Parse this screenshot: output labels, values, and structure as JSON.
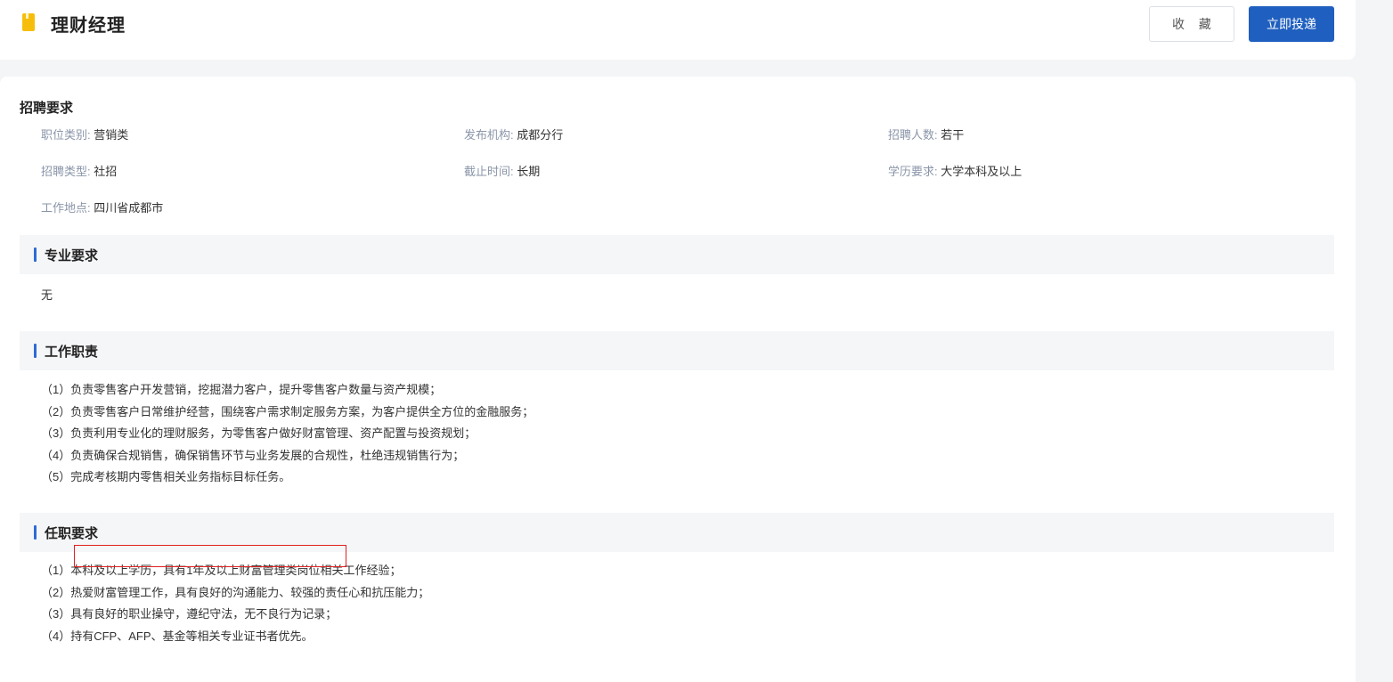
{
  "header": {
    "title": "理财经理",
    "collect_label": "收 藏",
    "apply_label": "立即投递"
  },
  "requirements": {
    "heading": "招聘要求",
    "items": [
      {
        "key": "职位类别:",
        "value": "营销类"
      },
      {
        "key": "发布机构:",
        "value": "成都分行"
      },
      {
        "key": "招聘人数:",
        "value": "若干"
      },
      {
        "key": "招聘类型:",
        "value": "社招"
      },
      {
        "key": "截止时间:",
        "value": "长期"
      },
      {
        "key": "学历要求:",
        "value": "大学本科及以上"
      },
      {
        "key": "工作地点:",
        "value": "四川省成都市"
      }
    ]
  },
  "major": {
    "title": "专业要求",
    "text": "无"
  },
  "duties": {
    "title": "工作职责",
    "lines": [
      "（1）负责零售客户开发营销，挖掘潜力客户，提升零售客户数量与资产规模；",
      "（2）负责零售客户日常维护经营，围绕客户需求制定服务方案，为客户提供全方位的金融服务；",
      "（3）负责利用专业化的理财服务，为零售客户做好财富管理、资产配置与投资规划；",
      "（4）负责确保合规销售，确保销售环节与业务发展的合规性，杜绝违规销售行为；",
      "（5）完成考核期内零售相关业务指标目标任务。"
    ]
  },
  "qualifications": {
    "title": "任职要求",
    "lines": [
      "（1）本科及以上学历，具有1年及以上财富管理类岗位相关工作经验；",
      "（2）热爱财富管理工作，具有良好的沟通能力、较强的责任心和抗压能力；",
      "（3）具有良好的职业操守，遵纪守法，无不良行为记录；",
      "（4）持有CFP、AFP、基金等相关专业证书者优先。"
    ]
  },
  "colors": {
    "primary": "#1f5fbf",
    "accent_bar": "#2d6bd6",
    "title_icon": "#f7bd0c",
    "highlight": "#e02020"
  }
}
